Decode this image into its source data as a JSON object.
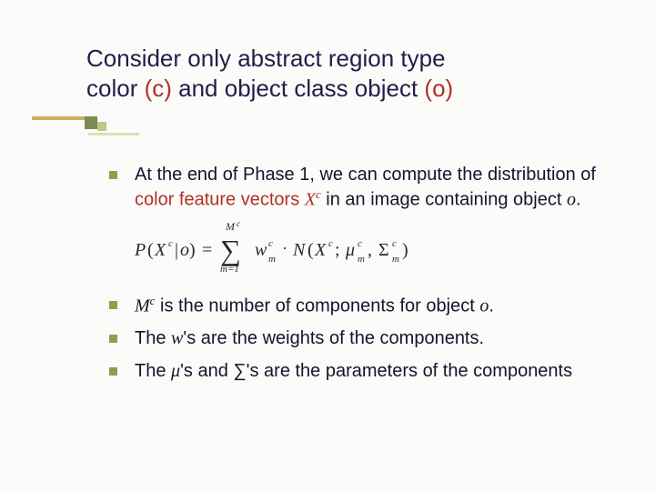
{
  "title": {
    "line1_pre": "Consider only abstract region type",
    "line2_pre": " color ",
    "line2_c": "(c)",
    "line2_mid": " and object class object ",
    "line2_o": "(o)"
  },
  "bullets": {
    "b1_a": "At the end of Phase 1, we can compute the distribution of  ",
    "b1_red": "color feature vectors ",
    "b1_Xc_X": "X",
    "b1_Xc_c": "c",
    "b1_b": " in an image containing object ",
    "b1_o": "o",
    "b1_dot": ".",
    "b2_M": "M",
    "b2_c": "c",
    "b2_mid": " is the number of components for object ",
    "b2_o": "o",
    "b2_dot": ".",
    "b3_a": "The ",
    "b3_w": "w",
    "b3_b": "'s are the weights of the components.",
    "b4_a": "The ",
    "b4_mu": "μ",
    "b4_b": "'s and ",
    "b4_sig": "∑",
    "b4_c": "'s are the parameters of the components"
  },
  "formula": {
    "lhs_P": "P",
    "lhs_open": "(",
    "lhs_X": "X",
    "lhs_c": "c",
    "lhs_bar": "|",
    "lhs_o": "o",
    "lhs_close": ")",
    "eq": "=",
    "sum_top_M": "M",
    "sum_top_c": "c",
    "sum_sym": "∑",
    "sum_bot": "m=1",
    "w": "w",
    "w_sub": "m",
    "w_sup": "c",
    "dot": "·",
    "N": "N",
    "N_open": "(",
    "N_X": "X",
    "N_Xc": "c",
    "semi": ";",
    "mu": "μ",
    "mu_sub": "m",
    "mu_sup": "c",
    "comma": ",",
    "Sig": "Σ",
    "Sig_sub": "m",
    "Sig_sup": "c",
    "N_close": ")"
  }
}
